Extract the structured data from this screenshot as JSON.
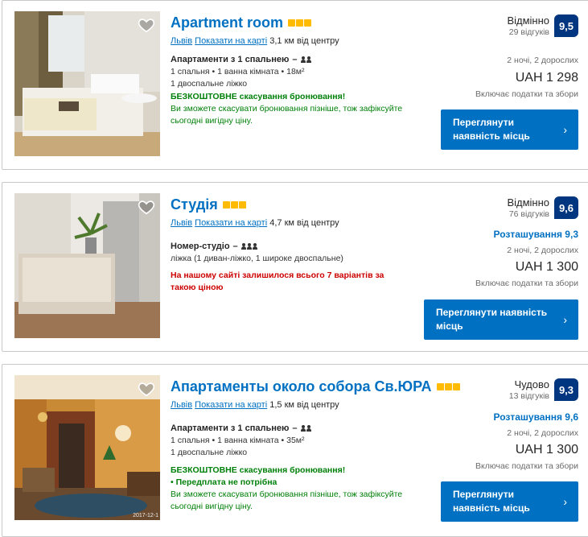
{
  "listings": [
    {
      "title": "Apartment room",
      "city": "Львів",
      "map_link": "Показати на карті",
      "distance": "3,1 км від центру",
      "room_type": "Апартаменти з 1 спальнею",
      "room_type_dash": "–",
      "details": "1 спальня • 1 ванна кімната • 18м²",
      "beds": "1 двоспальне ліжко",
      "free_cancel": "БЕЗКОШТОВНЕ скасування бронювання!",
      "note": "Ви зможете скасувати бронювання пізніше, тож зафіксуйте сьогодні вигідну ціну.",
      "rating_word": "Відмінно",
      "reviews": "29 відгуків",
      "score": "9,5",
      "nights": "2 ночі, 2 дорослих",
      "price": "UAH 1 298",
      "taxes": "Включає податки та збори",
      "button": "Переглянути наявність місць",
      "stars": 3,
      "guests": 2
    },
    {
      "title": "Студія",
      "city": "Львів",
      "map_link": "Показати на карті",
      "distance": "4,7 км від центру",
      "room_type": "Номер-студіо",
      "room_type_dash": "–",
      "beds": "ліжка (1 диван-ліжко, 1 широке двоспальне)",
      "scarcity": "На нашому сайті залишилося всього 7 варіантів за такою ціною",
      "rating_word": "Відмінно",
      "reviews": "76 відгуків",
      "score": "9,6",
      "location_score": "Розташування 9,3",
      "nights": "2 ночі, 2 дорослих",
      "price": "UAH 1 300",
      "taxes": "Включає податки та збори",
      "button": "Переглянути наявність місць",
      "stars": 3,
      "guests": 3
    },
    {
      "title": "Апартаменты около собора Св.ЮРА",
      "city": "Львів",
      "map_link": "Показати на карті",
      "distance": "1,5 км від центру",
      "room_type": "Апартаменти з 1 спальнею",
      "room_type_dash": "–",
      "details": "1 спальня • 1 ванна кімната • 35м²",
      "beds": "1 двоспальне ліжко",
      "free_cancel": "БЕЗКОШТОВНЕ скасування бронювання!",
      "no_prepay": "• Передплата не потрібна",
      "note": "Ви зможете скасувати бронювання пізніше, тож зафіксуйте сьогодні вигідну ціну.",
      "photo_timestamp": "2017-12-1",
      "rating_word": "Чудово",
      "reviews": "13 відгуків",
      "score": "9,3",
      "location_score": "Розташування 9,6",
      "nights": "2 ночі, 2 дорослих",
      "price": "UAH 1 300",
      "taxes": "Включає податки та збори",
      "button": "Переглянути наявність місць",
      "stars": 3,
      "guests": 2
    }
  ],
  "icons": {
    "favorite": "heart-icon",
    "chevron": "chevron-right-icon"
  },
  "colors": {
    "link": "#0071c2",
    "score_bg": "#003580",
    "star": "#febb02",
    "green": "#008009",
    "red": "#cc0000"
  }
}
